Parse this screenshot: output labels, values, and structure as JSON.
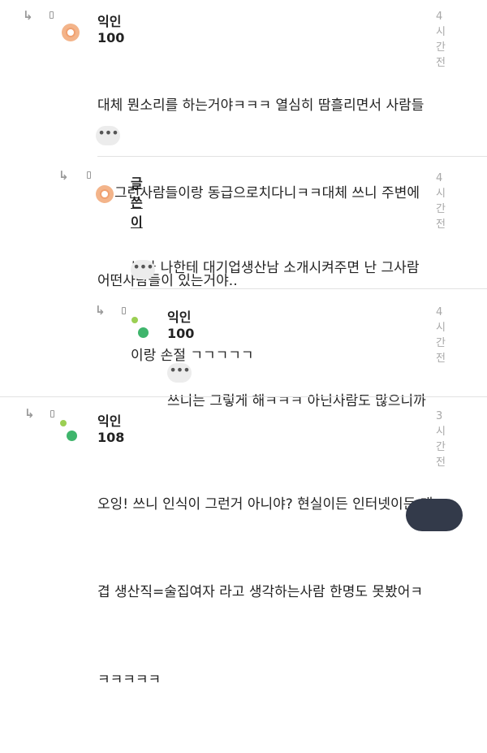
{
  "comments": [
    {
      "author": "익인100",
      "time": "4시간전",
      "lines": [
        "대체 뭔소리를 하는거야ㅋㅋㅋ 열심히 땀흘리면서 사람들",
        "을 그런사람들이랑 동급으로치다니ㅋㅋ대체 쓰니 주변에",
        "어떤사람들이 있는거야.."
      ],
      "more_label": "•••"
    },
    {
      "author": "글쓴이",
      "time": "4시간전",
      "lines": [
        "누가 나한테 대기업생산남 소개시켜주면 난 그사람",
        "이랑 손절 ㄱㄱㄱㄱㄱ"
      ],
      "more_label": "•••"
    },
    {
      "author": "익인100",
      "time": "4시간전",
      "lines": [
        "쓰니는 그렇게 해ㅋㅋㅋ 아닌사람도 많으니까"
      ],
      "more_label": "•••"
    },
    {
      "author": "익인108",
      "time": "3시간전",
      "lines": [
        "오잉! 쓰니 인식이 그런거 아니야? 현실이든 인터넷이든 대",
        "겹 생산직=술집여자 라고 생각하는사람 한명도 못봤어ㅋ",
        "ㅋㅋㅋㅋㅋ"
      ]
    }
  ],
  "icons": {
    "reply": "reply-arrow-icon",
    "menu": "small-menu-icon"
  },
  "colors": {
    "avatar_orange": "#f3b48a",
    "dot_green": "#3fb56c",
    "dot_lime": "#9bcf53"
  }
}
